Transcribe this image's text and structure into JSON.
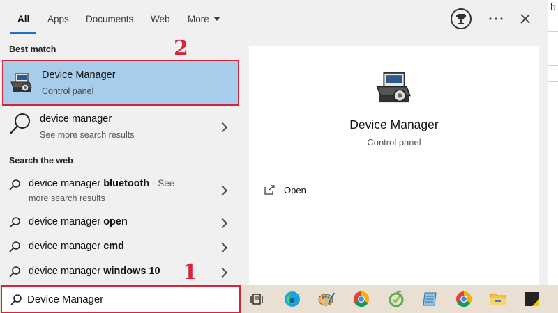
{
  "tabs": [
    {
      "label": "All",
      "active": true
    },
    {
      "label": "Apps"
    },
    {
      "label": "Documents"
    },
    {
      "label": "Web"
    },
    {
      "label": "More"
    }
  ],
  "sections": {
    "best_match": "Best match",
    "search_web": "Search the web"
  },
  "best_match": {
    "title": "Device Manager",
    "subtitle": "Control panel"
  },
  "see_more": {
    "title": "device manager",
    "subtitle": "See more search results"
  },
  "web_results": [
    {
      "prefix": "device manager ",
      "bold": "bluetooth",
      "suffix": " - See",
      "line2": "more search results"
    },
    {
      "prefix": "device manager ",
      "bold": "open"
    },
    {
      "prefix": "device manager ",
      "bold": "cmd"
    },
    {
      "prefix": "device manager ",
      "bold": "windows 10"
    }
  ],
  "preview": {
    "title": "Device Manager",
    "subtitle": "Control panel",
    "action": "Open"
  },
  "search": {
    "value": "Device Manager"
  },
  "annotations": {
    "step1": "1",
    "step2": "2"
  },
  "background": {
    "char": "b"
  },
  "colors": {
    "accent": "#1a73c7",
    "highlight": "#a7cdea",
    "annotation": "#d3263a"
  }
}
